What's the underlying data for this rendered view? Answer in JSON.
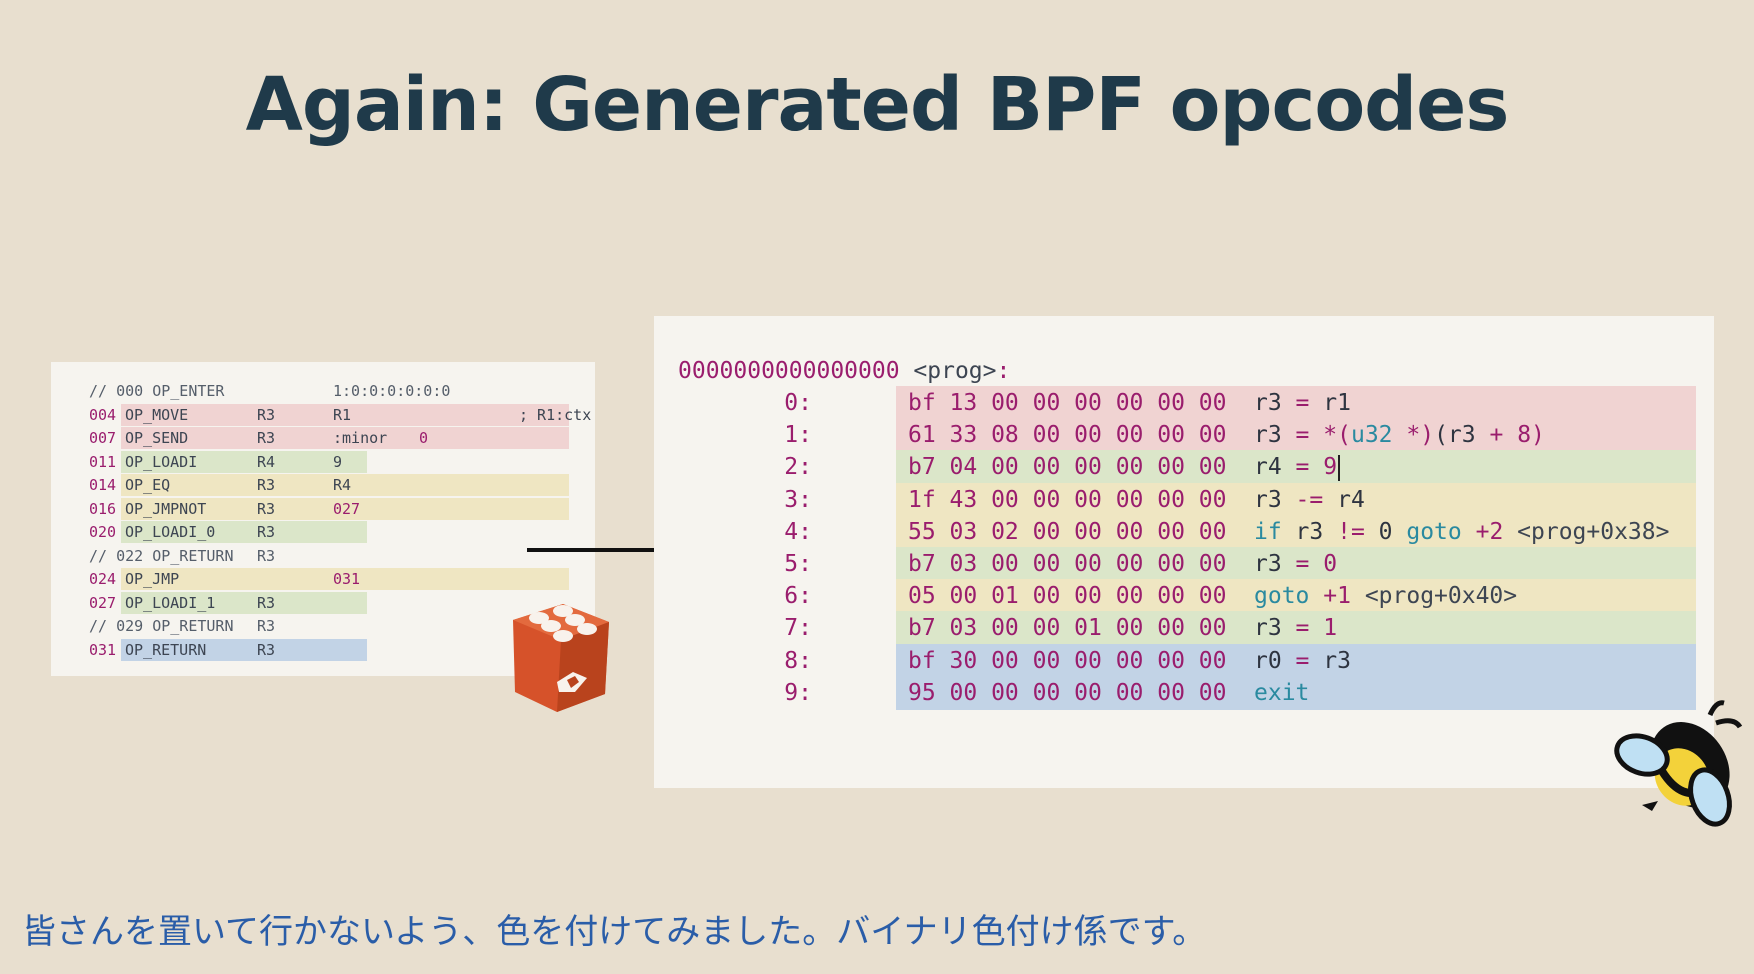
{
  "title": "Again: Generated BPF opcodes",
  "subtitle": "皆さんを置いて行かないよう、色を付けてみました。バイナリ色付け係です。",
  "vm_listing": [
    {
      "addr": "",
      "op": "// 000 OP_ENTER",
      "a1": "",
      "a2": "1:0:0:0:0:0:0",
      "note": "",
      "color": "none",
      "comment": true
    },
    {
      "addr": "004",
      "op": "OP_MOVE",
      "a1": "R3",
      "a2": "R1",
      "note": "; R1:ctx",
      "color": "red"
    },
    {
      "addr": "007",
      "op": "OP_SEND",
      "a1": "R3",
      "a2": ":minor",
      "a2num": "0",
      "note": "",
      "color": "red"
    },
    {
      "addr": "011",
      "op": "OP_LOADI",
      "a1": "R4",
      "a2": "9",
      "note": "",
      "color": "green"
    },
    {
      "addr": "014",
      "op": "OP_EQ",
      "a1": "R3",
      "a2": "R4",
      "note": "",
      "color": "yellow"
    },
    {
      "addr": "016",
      "op": "OP_JMPNOT",
      "a1": "R3",
      "a2": "027",
      "note": "",
      "color": "yellow"
    },
    {
      "addr": "020",
      "op": "OP_LOADI_0",
      "a1": "R3",
      "a2": "",
      "note": "",
      "color": "green"
    },
    {
      "addr": "",
      "op": "// 022 OP_RETURN",
      "a1": "R3",
      "a2": "",
      "note": "",
      "color": "none",
      "comment": true
    },
    {
      "addr": "024",
      "op": "OP_JMP",
      "a1": "",
      "a2": "031",
      "note": "",
      "color": "yellow"
    },
    {
      "addr": "027",
      "op": "OP_LOADI_1",
      "a1": "R3",
      "a2": "",
      "note": "",
      "color": "green"
    },
    {
      "addr": "",
      "op": "// 029 OP_RETURN",
      "a1": "R3",
      "a2": "",
      "note": "",
      "color": "none",
      "comment": true
    },
    {
      "addr": "031",
      "op": "OP_RETURN",
      "a1": "R3",
      "a2": "",
      "note": "",
      "color": "blue"
    }
  ],
  "bpf": {
    "header_addr": "0000000000000000",
    "header_label": "<prog>",
    "rows": [
      {
        "idx": "0:",
        "hex": "bf 13 00 00 00 00 00 00",
        "asm": "r3 = r1",
        "color": "red"
      },
      {
        "idx": "1:",
        "hex": "61 33 08 00 00 00 00 00",
        "asm": "r3 = *(u32 *)(r3 + 8)",
        "color": "red"
      },
      {
        "idx": "2:",
        "hex": "b7 04 00 00 00 00 00 00",
        "asm": "r4 = 9",
        "color": "green"
      },
      {
        "idx": "3:",
        "hex": "1f 43 00 00 00 00 00 00",
        "asm": "r3 -= r4",
        "color": "yellow"
      },
      {
        "idx": "4:",
        "hex": "55 03 02 00 00 00 00 00",
        "asm": "if r3 != 0 goto +2 <prog+0x38>",
        "color": "yellow"
      },
      {
        "idx": "5:",
        "hex": "b7 03 00 00 00 00 00 00",
        "asm": "r3 = 0",
        "color": "green"
      },
      {
        "idx": "6:",
        "hex": "05 00 01 00 00 00 00 00",
        "asm": "goto +1 <prog+0x40>",
        "color": "yellow"
      },
      {
        "idx": "7:",
        "hex": "b7 03 00 00 01 00 00 00",
        "asm": "r3 = 1",
        "color": "green"
      },
      {
        "idx": "8:",
        "hex": "bf 30 00 00 00 00 00 00",
        "asm": "r0 = r3",
        "color": "blue"
      },
      {
        "idx": "9:",
        "hex": "95 00 00 00 00 00 00 00",
        "asm": "exit",
        "color": "blue"
      }
    ]
  },
  "icons": {
    "logo": "mruby-cube-icon",
    "mascot": "bee-icon",
    "arrow": "right-arrow-icon"
  },
  "colors": {
    "red": "#f0d3d2",
    "green": "#dbe6c9",
    "yellow": "#efe6c2",
    "blue": "#c2d3e6",
    "title": "#1f3a4a",
    "subtitle": "#2a5da8"
  }
}
